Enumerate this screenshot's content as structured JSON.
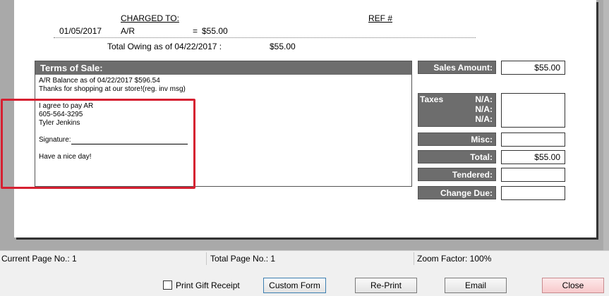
{
  "receipt": {
    "charged_to_header": "CHARGED TO:",
    "ref_header": "REF #",
    "line": {
      "date": "01/05/2017",
      "account": "A/R",
      "equals": "=",
      "amount": "$55.00"
    },
    "total_owing_label": "Total Owing as of 04/22/2017 :",
    "total_owing_value": "$55.00"
  },
  "terms": {
    "title": "Terms of Sale:",
    "lines": [
      "A/R Balance as of 04/22/2017  $596.54",
      "Thanks for shopping at our store!(reg. inv msg)",
      "I agree to pay AR",
      "605-564-3295",
      "Tyler Jenkins",
      "Signature:",
      "Have a nice day!"
    ]
  },
  "summary": {
    "sales_amount_label": "Sales Amount:",
    "sales_amount_value": "$55.00",
    "taxes_label": "Taxes",
    "taxes_na": [
      "N/A:",
      "N/A:",
      "N/A:"
    ],
    "misc_label": "Misc:",
    "misc_value": "",
    "total_label": "Total:",
    "total_value": "$55.00",
    "tendered_label": "Tendered:",
    "tendered_value": "",
    "change_due_label": "Change Due:",
    "change_due_value": ""
  },
  "status": {
    "current_page": "Current Page No.: 1",
    "total_page": "Total Page No.: 1",
    "zoom": "Zoom Factor: 100%"
  },
  "actions": {
    "print_gift_receipt": "Print Gift Receipt",
    "custom_form": "Custom Form",
    "reprint": "Re-Print",
    "email": "Email",
    "close": "Close"
  },
  "colors": {
    "highlight": "#d62031",
    "label_fill": "#6d6d6d"
  }
}
